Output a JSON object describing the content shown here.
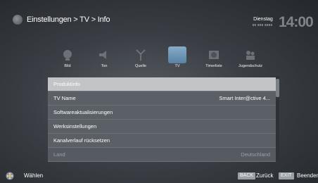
{
  "header": {
    "breadcrumb": "Einstellungen > TV > Info",
    "day": "Dienstag",
    "date": "xx xxx xxxx",
    "time": "14:00"
  },
  "categories": [
    {
      "label": "Bild",
      "icon": "picture-icon"
    },
    {
      "label": "Ton",
      "icon": "speaker-icon"
    },
    {
      "label": "Quelle",
      "icon": "antenna-icon"
    },
    {
      "label": "TV",
      "icon": "tv-icon",
      "active": true
    },
    {
      "label": "Timerliste",
      "icon": "timer-icon"
    },
    {
      "label": "Jugendschutz",
      "icon": "parental-lock-icon"
    }
  ],
  "menu": {
    "rows": [
      {
        "label": "Produktinfo",
        "value": "",
        "selected": true
      },
      {
        "label": "TV Name",
        "value": "Smart Inter@ctive 4..."
      },
      {
        "label": "Softwareaktualisierungen",
        "value": ""
      },
      {
        "label": "Werksinstellungen",
        "value": ""
      },
      {
        "label": "Kanalverlauf rücksetzen",
        "value": ""
      },
      {
        "label": "Land",
        "value": "Deutschland",
        "disabled": true
      }
    ]
  },
  "footer": {
    "select_label": "Wählen",
    "back_key": "BACK",
    "back_label": "Zurück",
    "exit_key": "EXIT",
    "exit_label": "Beenden"
  },
  "colors": {
    "selected_row": "#c2c4c6",
    "row_bg": "#5b6066",
    "active_category": "#7aa6c8"
  }
}
